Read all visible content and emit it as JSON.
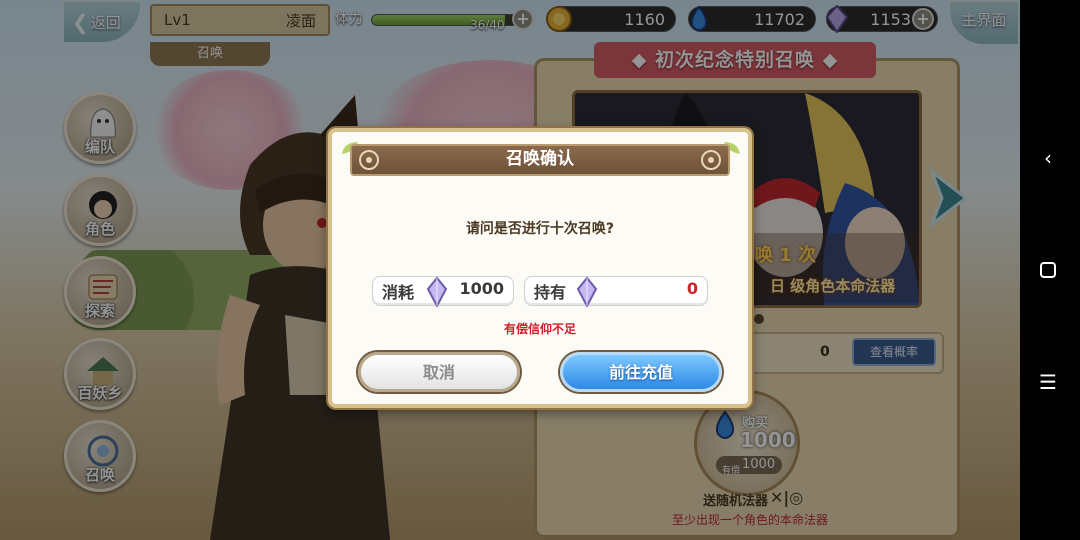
{
  "hud": {
    "back_label": "返回",
    "level": "Lv1",
    "player_name": "凌面",
    "tab": "召唤",
    "stamina_label": "体力",
    "stamina_count": "36/40",
    "stamina_fraction": 0.9,
    "gold": "1160",
    "blue_gem": "11702",
    "crystal": "1153",
    "home_label": "主界面"
  },
  "menu": {
    "items": [
      {
        "label": "编队"
      },
      {
        "label": "角色"
      },
      {
        "label": "探索"
      },
      {
        "label": "百妖乡"
      },
      {
        "label": "召唤"
      }
    ]
  },
  "banner": {
    "title": "◆ 初次纪念特别召唤 ◆",
    "art_text_1": "唤 1 次",
    "art_text_2": "日 级角色本命法器",
    "count": "0",
    "prob_button": "查看概率",
    "buy_label": "购买",
    "buy_amount": "1000",
    "owned_small": "有偿",
    "owned_value": "1000",
    "gift_text": "送随机法器",
    "gift_icons": "✕|◎",
    "bottom_note": "至少出现一个角色的本命法器"
  },
  "dialog": {
    "title": "召唤确认",
    "question": "请问是否进行十次召唤?",
    "cost_label": "消耗",
    "cost_value": "1000",
    "owned_label": "持有",
    "owned_value": "0",
    "warning": "有偿信仰不足",
    "cancel": "取消",
    "charge": "前往充值"
  },
  "colors": {
    "warning": "#d0202a",
    "charge_button": "#2d89e6",
    "banner_red": "#d55e66"
  },
  "icons": {
    "back": "chevron-left-icon",
    "gold": "gold-coin-icon",
    "blue_gem": "blue-flame-gem-icon",
    "crystal": "crystal-icon",
    "plus": "plus-icon",
    "sys_back": "chevron-left-icon",
    "sys_home": "square-icon",
    "sys_menu": "hamburger-icon"
  }
}
